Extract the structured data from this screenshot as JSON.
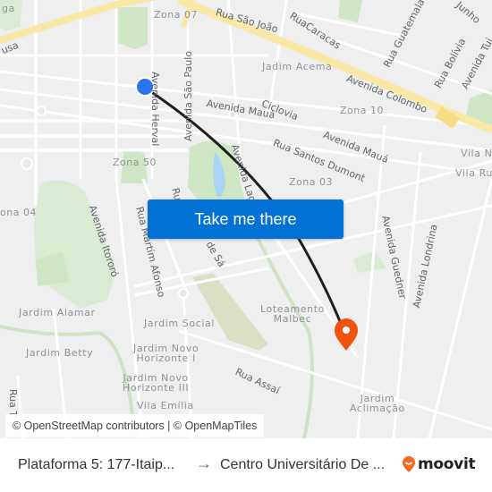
{
  "map": {
    "street_labels": [
      {
        "text": "Rua São João",
        "key": "rua-sao-joao"
      },
      {
        "text": "RuaCaracas",
        "key": "rua-caracas"
      },
      {
        "text": "Rua Guatemala",
        "key": "rua-guatemala"
      },
      {
        "text": "Junho",
        "key": "junho"
      },
      {
        "text": "Rua Bolívia",
        "key": "rua-bolivia"
      },
      {
        "text": "Avenida Tui",
        "key": "avenida-tui"
      },
      {
        "text": "Avenida Colombo",
        "key": "avenida-colombo"
      },
      {
        "text": "Ciclovia",
        "key": "ciclovia"
      },
      {
        "text": "Avenida Mauá",
        "key": "avenida-maua-1"
      },
      {
        "text": "Avenida Mauá",
        "key": "avenida-maua-2"
      },
      {
        "text": "Rua Santos Dumont",
        "key": "rua-santos-dumont"
      },
      {
        "text": "Avenida Herval",
        "key": "avenida-herval"
      },
      {
        "text": "Avenida São Paulo",
        "key": "avenida-sao-paulo"
      },
      {
        "text": "Avenida Lag",
        "key": "avenida-lag"
      },
      {
        "text": "Avenida Itororó",
        "key": "avenida-itororo"
      },
      {
        "text": "Rua Martim Afonso",
        "key": "rua-martim-afonso"
      },
      {
        "text": "Ru",
        "key": "ru-partial"
      },
      {
        "text": "de Sá",
        "key": "de-sa"
      },
      {
        "text": "Avenida Guedner",
        "key": "avenida-guedner"
      },
      {
        "text": "Avenida Londrina",
        "key": "avenida-londrina"
      },
      {
        "text": "Rua Assaí",
        "key": "rua-assai"
      },
      {
        "text": "Rua T",
        "key": "rua-t"
      },
      {
        "text": "usa",
        "key": "usa-partial"
      }
    ],
    "zone_labels": [
      {
        "text": "Zona 07"
      },
      {
        "text": "Zona 10"
      },
      {
        "text": "Zona 50"
      },
      {
        "text": "Zona 03"
      },
      {
        "text": "ona 04"
      }
    ],
    "neighborhood_labels": [
      {
        "text": "Jadim Acema"
      },
      {
        "text": "Vila N"
      },
      {
        "text": "Vila Ru"
      },
      {
        "text": "Jardim Alamar"
      },
      {
        "text": "Jardim Social"
      },
      {
        "text": "Jardim Betty"
      },
      {
        "text": "Jardim Novo\nHorizonte I"
      },
      {
        "text": "Jardim Novo\nHorizonte III"
      },
      {
        "text": "Vila Emília"
      },
      {
        "text": "Loteamento\nMalbec"
      },
      {
        "text": "Jardim\nAclimação"
      },
      {
        "text": "ga"
      }
    ],
    "origin_marker_color": "#2a74f0",
    "destination_marker_color": "#f0530f",
    "route_color": "#1f1f1f"
  },
  "cta": {
    "label": "Take me there",
    "color": "#0372d6"
  },
  "attribution": "© OpenStreetMap contributors | © OpenMapTiles",
  "footer": {
    "origin": "Plataforma 5: 177-Itaip...",
    "arrow": "→",
    "destination": "Centro Universitário De ...",
    "brand": "moovit",
    "brand_color": "#f26b21"
  }
}
